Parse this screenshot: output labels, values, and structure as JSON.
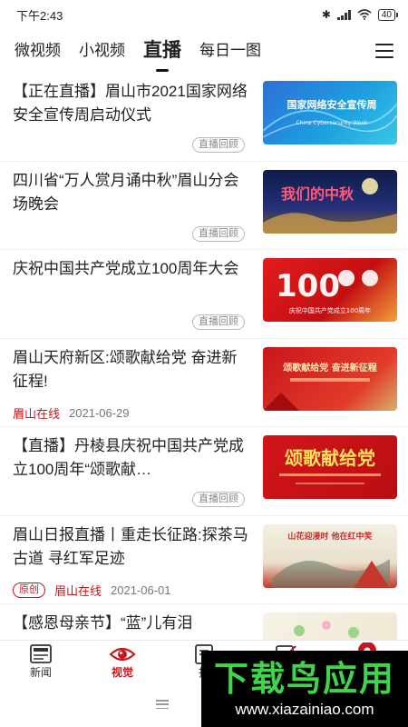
{
  "status_bar": {
    "time": "下午2:43",
    "battery": "40"
  },
  "tabs": [
    {
      "label": "微视频"
    },
    {
      "label": "小视频"
    },
    {
      "label": "直播"
    },
    {
      "label": "每日一图"
    }
  ],
  "feed": [
    {
      "title": "【正在直播】眉山市2021国家网络安全宣传周启动仪式",
      "replay": "直播回顾",
      "thumb_text": "国家网络安全宣传周",
      "thumb_sub": "China Cybersecurity Week"
    },
    {
      "title": "四川省“万人赏月诵中秋”眉山分会场晚会",
      "replay": "直播回顾",
      "thumb_text": "我们的中秋"
    },
    {
      "title": "庆祝中国共产党成立100周年大会",
      "replay": "直播回顾",
      "thumb_text": "庆祝中国共产党成立100周年"
    },
    {
      "title": "眉山天府新区:颂歌献给党 奋进新征程!",
      "source": "眉山在线",
      "date": "2021-06-29",
      "thumb_text": "颂歌献给党 奋进新征程"
    },
    {
      "title": "【直播】丹棱县庆祝中国共产党成立100周年“颂歌献…",
      "replay": "直播回顾",
      "thumb_text": "颂歌献给党"
    },
    {
      "title": "眉山日报直播丨重走长征路:探茶马古道 寻红军足迹",
      "badge": "原创",
      "source": "眉山在线",
      "date": "2021-06-01",
      "thumb_text": "山花迎漫时 他在红中笑"
    },
    {
      "title": "【感恩母亲节】“蓝”儿有泪"
    }
  ],
  "bottom_nav": [
    {
      "label": "新闻",
      "icon": "news-icon"
    },
    {
      "label": "视觉",
      "icon": "eye-icon"
    },
    {
      "label": "报",
      "icon": "paper-icon"
    },
    {
      "label": "",
      "icon": "edit-icon"
    },
    {
      "label": "",
      "icon": "location-icon"
    }
  ],
  "watermark": {
    "name": "下载鸟应用",
    "url": "www.xiazainiao.com"
  },
  "colors": {
    "accent": "#c8161d",
    "thumb_blue": "#2f6fd6",
    "watermark_green": "#3fd44a"
  }
}
